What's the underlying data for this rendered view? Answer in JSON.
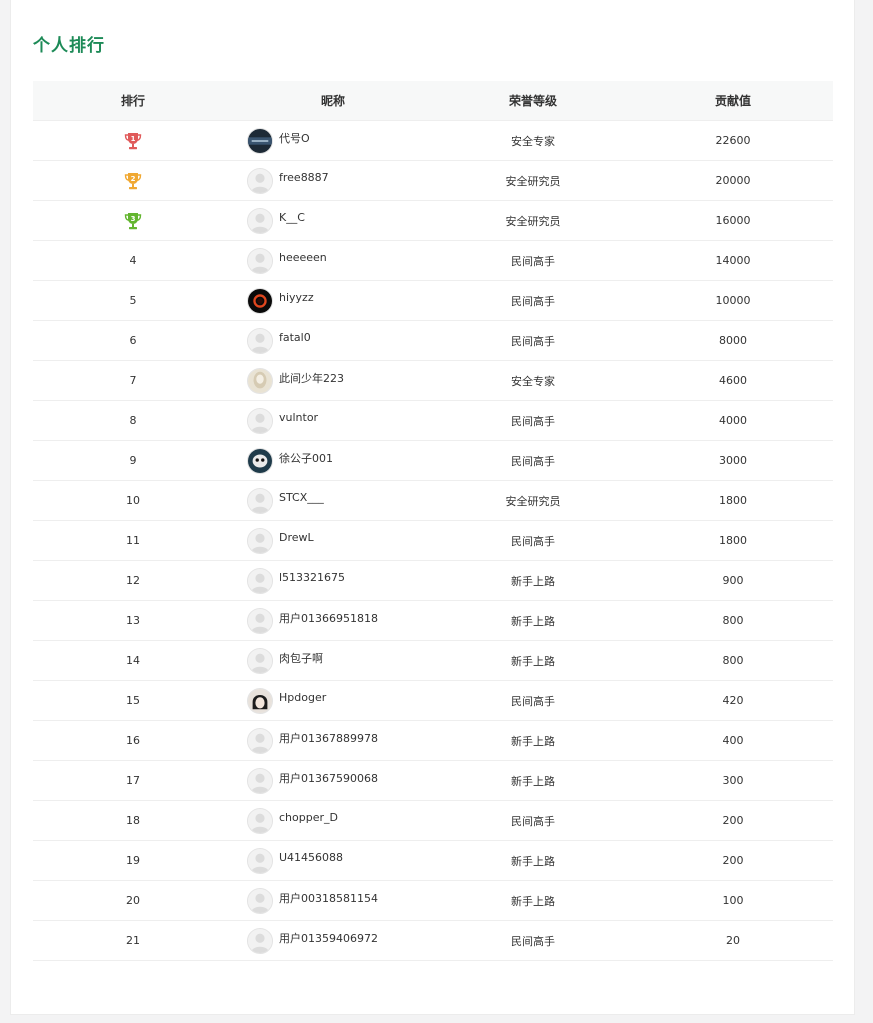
{
  "title": "个人排行",
  "columns": {
    "rank": "排行",
    "nickname": "昵称",
    "level": "荣誉等级",
    "contribution": "贡献值"
  },
  "trophy_colors": {
    "1": "#e05a5a",
    "2": "#f0a832",
    "3": "#63b52f"
  },
  "rows": [
    {
      "rank": "1",
      "nickname": "代号O",
      "level": "安全专家",
      "score": "22600",
      "avatar": "dark-photo-avatar"
    },
    {
      "rank": "2",
      "nickname": "free8887",
      "level": "安全研究员",
      "score": "20000",
      "avatar": "default-avatar"
    },
    {
      "rank": "3",
      "nickname": "K__C",
      "level": "安全研究员",
      "score": "16000",
      "avatar": "default-avatar"
    },
    {
      "rank": "4",
      "nickname": "heeeeen",
      "level": "民间高手",
      "score": "14000",
      "avatar": "default-avatar"
    },
    {
      "rank": "5",
      "nickname": "hiyyzz",
      "level": "民间高手",
      "score": "10000",
      "avatar": "red-ring-avatar"
    },
    {
      "rank": "6",
      "nickname": "fatal0",
      "level": "民间高手",
      "score": "8000",
      "avatar": "default-avatar"
    },
    {
      "rank": "7",
      "nickname": "此间少年223",
      "level": "安全专家",
      "score": "4600",
      "avatar": "light-photo-avatar"
    },
    {
      "rank": "8",
      "nickname": "vulntor",
      "level": "民间高手",
      "score": "4000",
      "avatar": "default-avatar"
    },
    {
      "rank": "9",
      "nickname": "徐公子001",
      "level": "民间高手",
      "score": "3000",
      "avatar": "cartoon-avatar"
    },
    {
      "rank": "10",
      "nickname": "STCX___",
      "level": "安全研究员",
      "score": "1800",
      "avatar": "default-avatar"
    },
    {
      "rank": "11",
      "nickname": "DrewL",
      "level": "民间高手",
      "score": "1800",
      "avatar": "default-avatar"
    },
    {
      "rank": "12",
      "nickname": "l513321675",
      "level": "新手上路",
      "score": "900",
      "avatar": "default-avatar"
    },
    {
      "rank": "13",
      "nickname": "用户01366951818",
      "level": "新手上路",
      "score": "800",
      "avatar": "default-avatar"
    },
    {
      "rank": "14",
      "nickname": "肉包子啊",
      "level": "新手上路",
      "score": "800",
      "avatar": "default-avatar"
    },
    {
      "rank": "15",
      "nickname": "Hpdoger",
      "level": "民间高手",
      "score": "420",
      "avatar": "anime-avatar"
    },
    {
      "rank": "16",
      "nickname": "用户01367889978",
      "level": "新手上路",
      "score": "400",
      "avatar": "default-avatar"
    },
    {
      "rank": "17",
      "nickname": "用户01367590068",
      "level": "新手上路",
      "score": "300",
      "avatar": "default-avatar"
    },
    {
      "rank": "18",
      "nickname": "chopper_D",
      "level": "民间高手",
      "score": "200",
      "avatar": "default-avatar"
    },
    {
      "rank": "19",
      "nickname": "U41456088",
      "level": "新手上路",
      "score": "200",
      "avatar": "default-avatar"
    },
    {
      "rank": "20",
      "nickname": "用户00318581154",
      "level": "新手上路",
      "score": "100",
      "avatar": "default-avatar"
    },
    {
      "rank": "21",
      "nickname": "用户01359406972",
      "level": "民间高手",
      "score": "20",
      "avatar": "default-avatar"
    }
  ]
}
